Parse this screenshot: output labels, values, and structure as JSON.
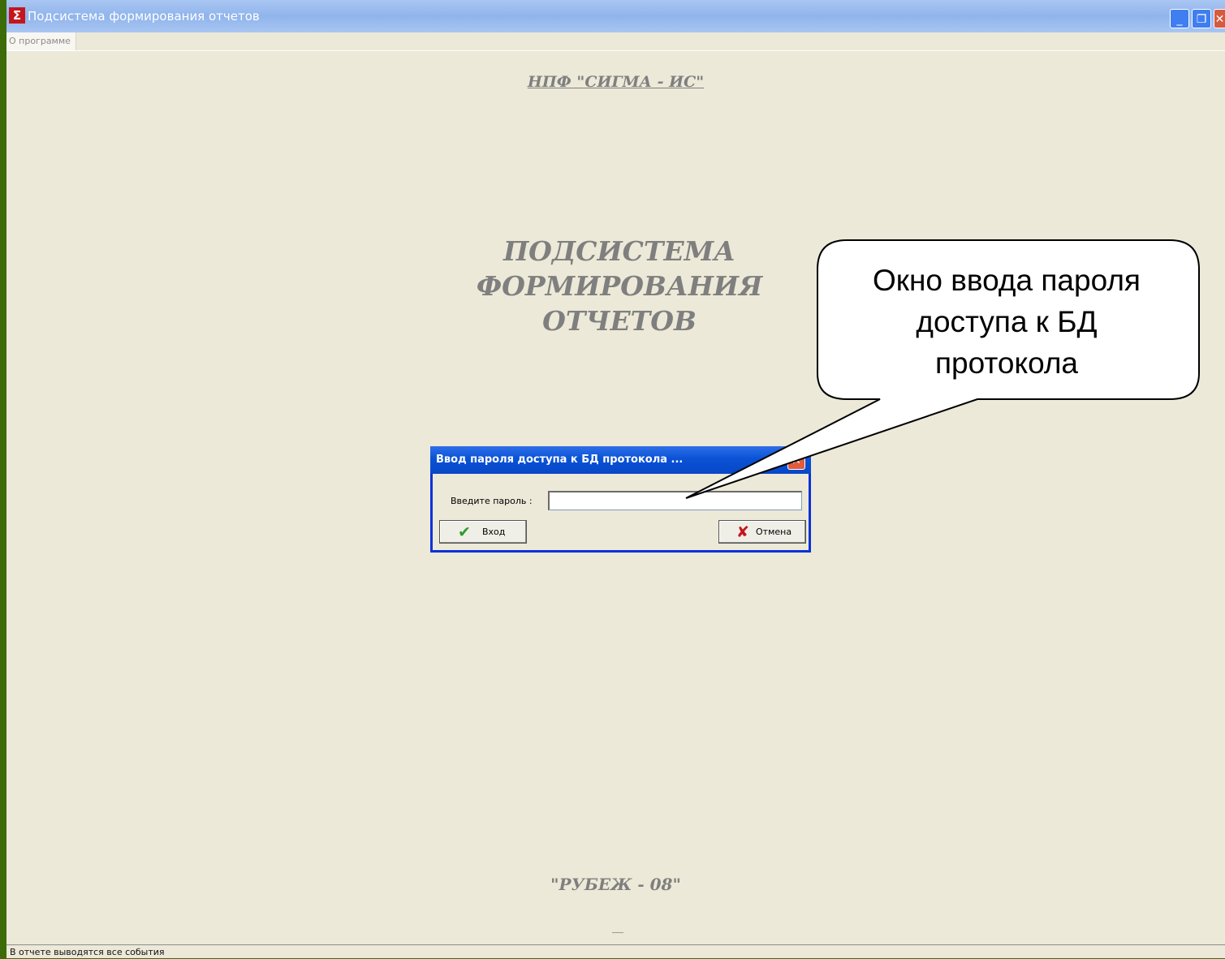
{
  "window": {
    "icon": "app-sigma-icon",
    "title": "Подсистема формирования отчетов",
    "controls": [
      "minimize",
      "restore",
      "close"
    ]
  },
  "menu": {
    "items": [
      {
        "label": "О программе"
      }
    ]
  },
  "content": {
    "company": "НПФ \"СИГМА - ИС\"",
    "title_lines": [
      "ПОДСИСТЕМА",
      "ФОРМИРОВАНИЯ",
      "ОТЧЕТОВ"
    ],
    "footer": "\"РУБЕЖ - 08\""
  },
  "dialog": {
    "title": "Ввод пароля доступа к БД протокола ...",
    "password_label": "Введите пароль :",
    "password_value": "",
    "ok_label": "Вход",
    "cancel_label": "Отмена"
  },
  "callout": {
    "lines": [
      "Окно ввода пароля",
      "доступа к БД",
      "протокола"
    ]
  },
  "status": {
    "text": "В отчете выводятся все события"
  }
}
